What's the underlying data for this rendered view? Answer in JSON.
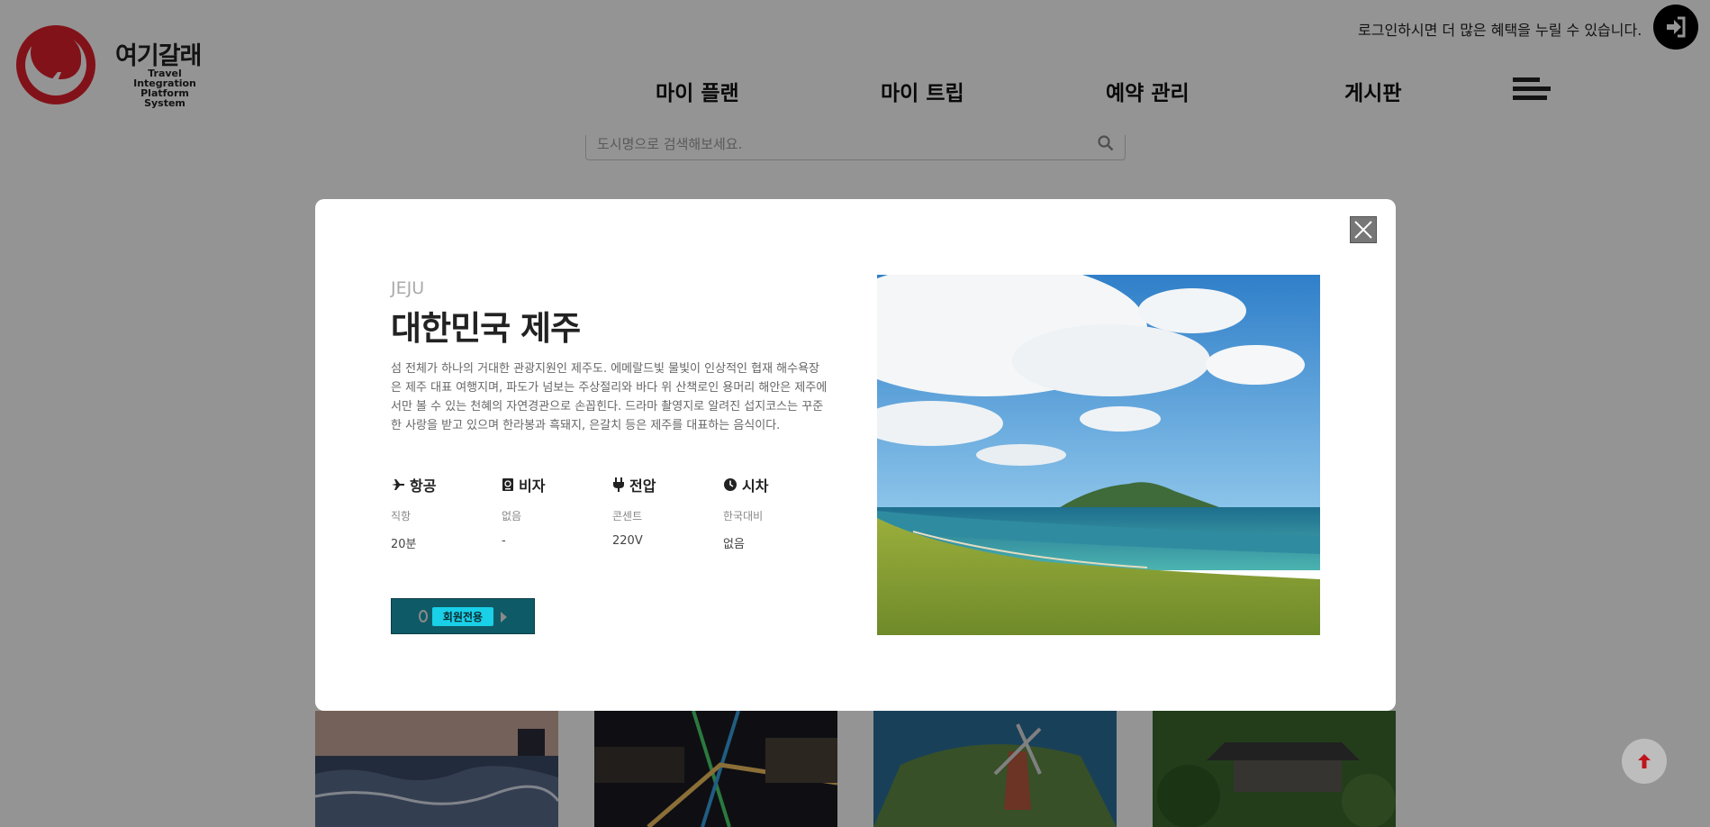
{
  "header": {
    "logo_title": "여기갈래",
    "logo_subtitle_line1": "Travel Integration",
    "logo_subtitle_line2": "Platform System",
    "login_message": "로그인하시면 더 많은 혜택을 누릴 수 있습니다.",
    "nav": [
      "마이 플랜",
      "마이 트립",
      "예약 관리",
      "게시판"
    ]
  },
  "search": {
    "placeholder": "도시명으로 검색해보세요."
  },
  "modal": {
    "city_code": "JEJU",
    "city_name": "대한민국 제주",
    "description": "섬 전체가 하나의 거대한 관광지원인 제주도. 에메랄드빛 물빛이 인상적인 협재 해수욕장은 제주 대표 여행지며, 파도가 넘보는 주상절리와 바다 위 산책로인 용머리 해안은 제주에서만 볼 수 있는 천혜의 자연경관으로 손꼽힌다. 드라마 촬영지로 알려진 섭지코스는 꾸준한 사랑을 받고 있으며 한라봉과 흑돼지, 은갈치 등은 제주를 대표하는 음식이다.",
    "info": [
      {
        "icon": "airplane-icon",
        "label": "항공",
        "sub": "직항",
        "value": "20분"
      },
      {
        "icon": "passport-icon",
        "label": "비자",
        "sub": "없음",
        "value": "-"
      },
      {
        "icon": "plug-icon",
        "label": "전압",
        "sub": "콘센트",
        "value": "220V"
      },
      {
        "icon": "clock-icon",
        "label": "시차",
        "sub": "한국대비",
        "value": "없음"
      }
    ],
    "member_button": "회원전용"
  },
  "colors": {
    "brand_red": "#e0202c",
    "member_button_bg": "#0e5a67",
    "member_pill": "#19d0e8",
    "top_arrow": "#c0141c"
  }
}
